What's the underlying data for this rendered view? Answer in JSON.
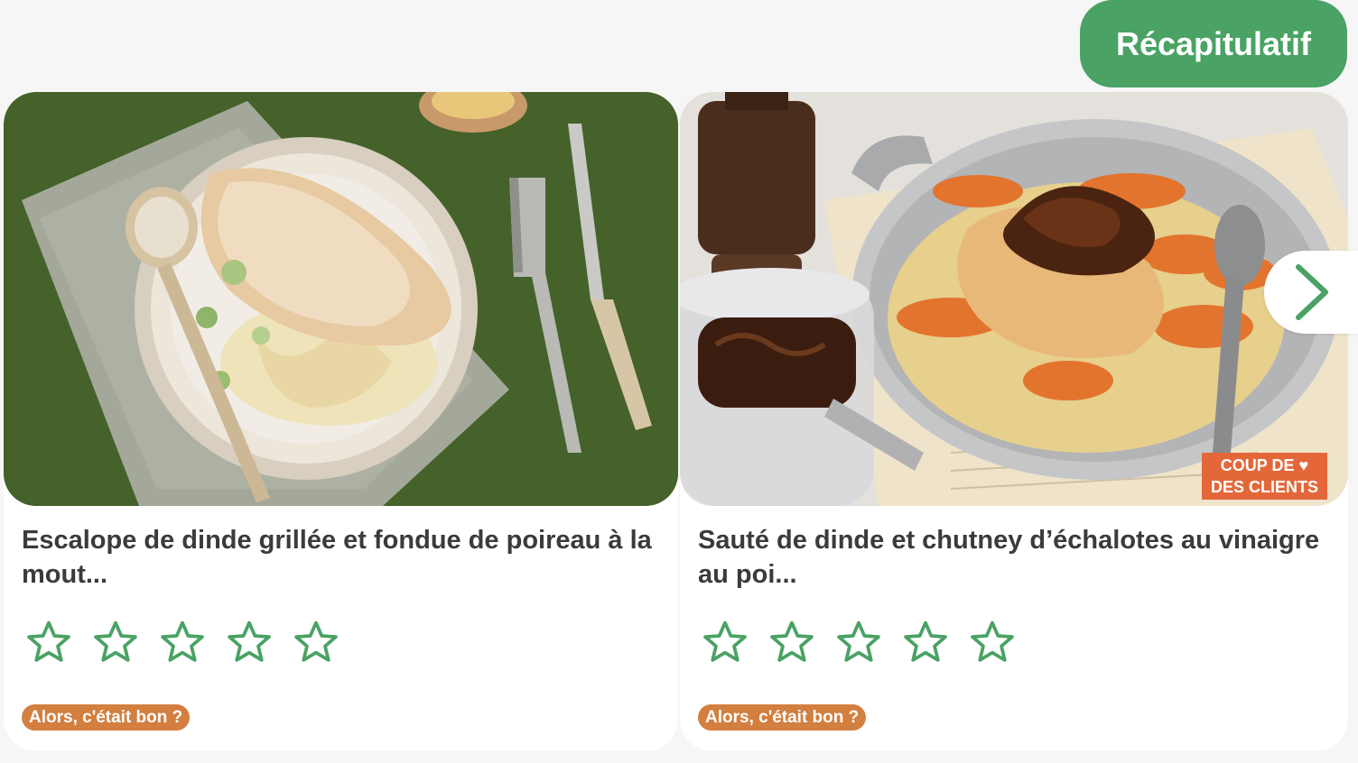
{
  "header": {
    "recap_label": "Récapitulatif"
  },
  "recipes": [
    {
      "title": "Escalope de dinde grillée et fondue de poireau à la mout...",
      "rating": 0,
      "max_rating": 5,
      "badge": "Alors, c'était bon ?"
    },
    {
      "title": "Sauté de dinde et chutney d’échalotes au vinaigre au poi...",
      "rating": 0,
      "max_rating": 5,
      "badge": "Alors, c'était bon ?",
      "promo_line1": "COUP DE",
      "promo_line2": "DES CLIENTS"
    }
  ],
  "icons": {
    "star": "star-outline-icon",
    "next": "chevron-right-icon",
    "heart": "heart-icon"
  },
  "colors": {
    "accent_green": "#4aa264",
    "badge_orange": "#d27f3f",
    "promo_orange": "#e4673a"
  }
}
